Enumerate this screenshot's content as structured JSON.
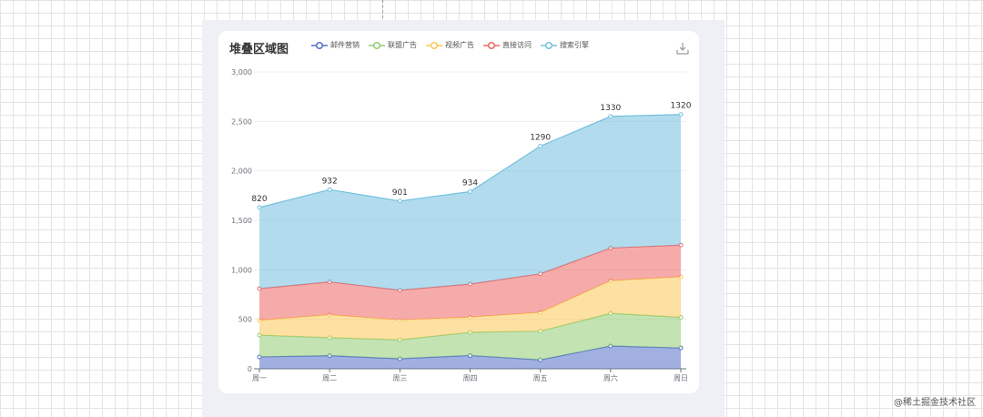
{
  "watermark": "@稀土掘金技术社区",
  "chart_data": {
    "type": "area",
    "title": "堆叠区域图",
    "stacked": true,
    "categories": [
      "周一",
      "周二",
      "周三",
      "周四",
      "周五",
      "周六",
      "周日"
    ],
    "ylim": [
      0,
      3000
    ],
    "yticks": [
      0,
      500,
      1000,
      1500,
      2000,
      2500,
      3000
    ],
    "ytick_labels": [
      "0",
      "500",
      "1,000",
      "1,500",
      "2,000",
      "2,500",
      "3,000"
    ],
    "legend_position": "top",
    "series": [
      {
        "name": "邮件营销",
        "color": "#5470c6",
        "values": [
          120,
          132,
          101,
          134,
          90,
          230,
          210
        ]
      },
      {
        "name": "联盟广告",
        "color": "#91cc75",
        "values": [
          220,
          182,
          191,
          234,
          290,
          330,
          310
        ]
      },
      {
        "name": "视频广告",
        "color": "#fac858",
        "values": [
          150,
          232,
          201,
          154,
          190,
          330,
          410
        ]
      },
      {
        "name": "直接访问",
        "color": "#ee6666",
        "values": [
          320,
          332,
          301,
          334,
          390,
          330,
          320
        ]
      },
      {
        "name": "搜索引擎",
        "color": "#73c0de",
        "values": [
          820,
          932,
          901,
          934,
          1290,
          1330,
          1320
        ],
        "show_labels": true
      }
    ]
  }
}
